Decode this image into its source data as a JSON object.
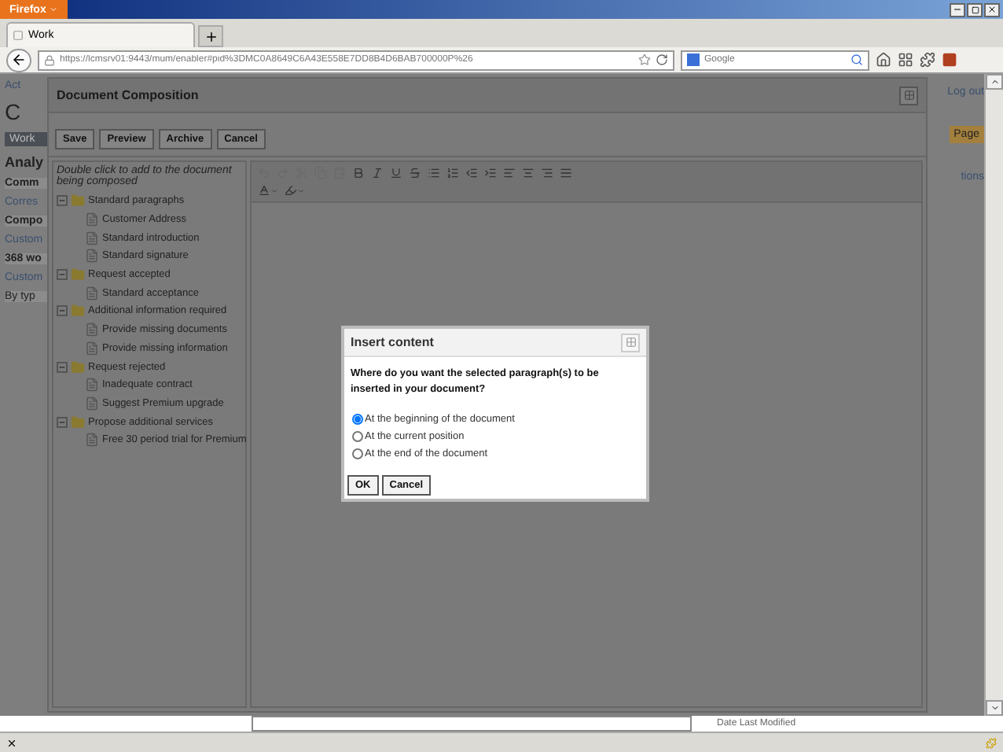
{
  "browser": {
    "menu_button": "Firefox",
    "tab": {
      "title": "Work",
      "selected": true
    },
    "url": "https://lcmsrv01:9443/mum/enabler#pid%3DMC0A8649C6A43E558E7DD8B4D6BAB700000P%26",
    "search": {
      "placeholder": "Google"
    }
  },
  "background_page": {
    "left": [
      {
        "kind": "link",
        "text": "Act"
      },
      {
        "kind": "logo",
        "text": "C"
      },
      {
        "kind": "nav",
        "text": "Work"
      },
      {
        "kind": "heading",
        "text": "Analy"
      },
      {
        "kind": "button",
        "text": "Comm"
      },
      {
        "kind": "label",
        "text": "Corres"
      },
      {
        "kind": "button",
        "text": "Compo"
      },
      {
        "kind": "label",
        "text": "Custom"
      },
      {
        "kind": "button",
        "text": "368 wo"
      },
      {
        "kind": "label",
        "text": "Custom"
      },
      {
        "kind": "field",
        "text": "By typ"
      }
    ],
    "right": [
      {
        "kind": "link",
        "text": "Log out"
      },
      {
        "kind": "nav",
        "text": "Page"
      },
      {
        "kind": "label",
        "text": "tions"
      }
    ],
    "footer_label": "Date Last Modified"
  },
  "dialog": {
    "title": "Document Composition",
    "buttons": [
      "Save",
      "Preview",
      "Archive",
      "Cancel"
    ],
    "hint": "Double click to add to the document being composed",
    "tree": [
      {
        "label": "Standard paragraphs",
        "expanded": true,
        "children": [
          {
            "label": "Customer Address"
          },
          {
            "label": "Standard introduction"
          },
          {
            "label": "Standard signature"
          }
        ]
      },
      {
        "label": "Request accepted",
        "expanded": true,
        "children": [
          {
            "label": "Standard acceptance"
          }
        ]
      },
      {
        "label": "Additional information required",
        "expanded": true,
        "children": [
          {
            "label": "Provide missing documents"
          },
          {
            "label": "Provide missing information"
          }
        ]
      },
      {
        "label": "Request rejected",
        "expanded": true,
        "children": [
          {
            "label": "Inadequate contract"
          },
          {
            "label": "Suggest Premium upgrade"
          }
        ]
      },
      {
        "label": "Propose additional services",
        "expanded": true,
        "children": [
          {
            "label": "Free 30 period trial for Premium"
          }
        ]
      }
    ]
  },
  "insert_dialog": {
    "title": "Insert content",
    "question": "Where do you want the selected paragraph(s) to be inserted in your document?",
    "options": [
      {
        "label": "At the beginning of the document",
        "selected": true
      },
      {
        "label": "At the current position",
        "selected": false
      },
      {
        "label": "At the end of the document",
        "selected": false
      }
    ],
    "buttons": [
      "OK",
      "Cancel"
    ]
  }
}
